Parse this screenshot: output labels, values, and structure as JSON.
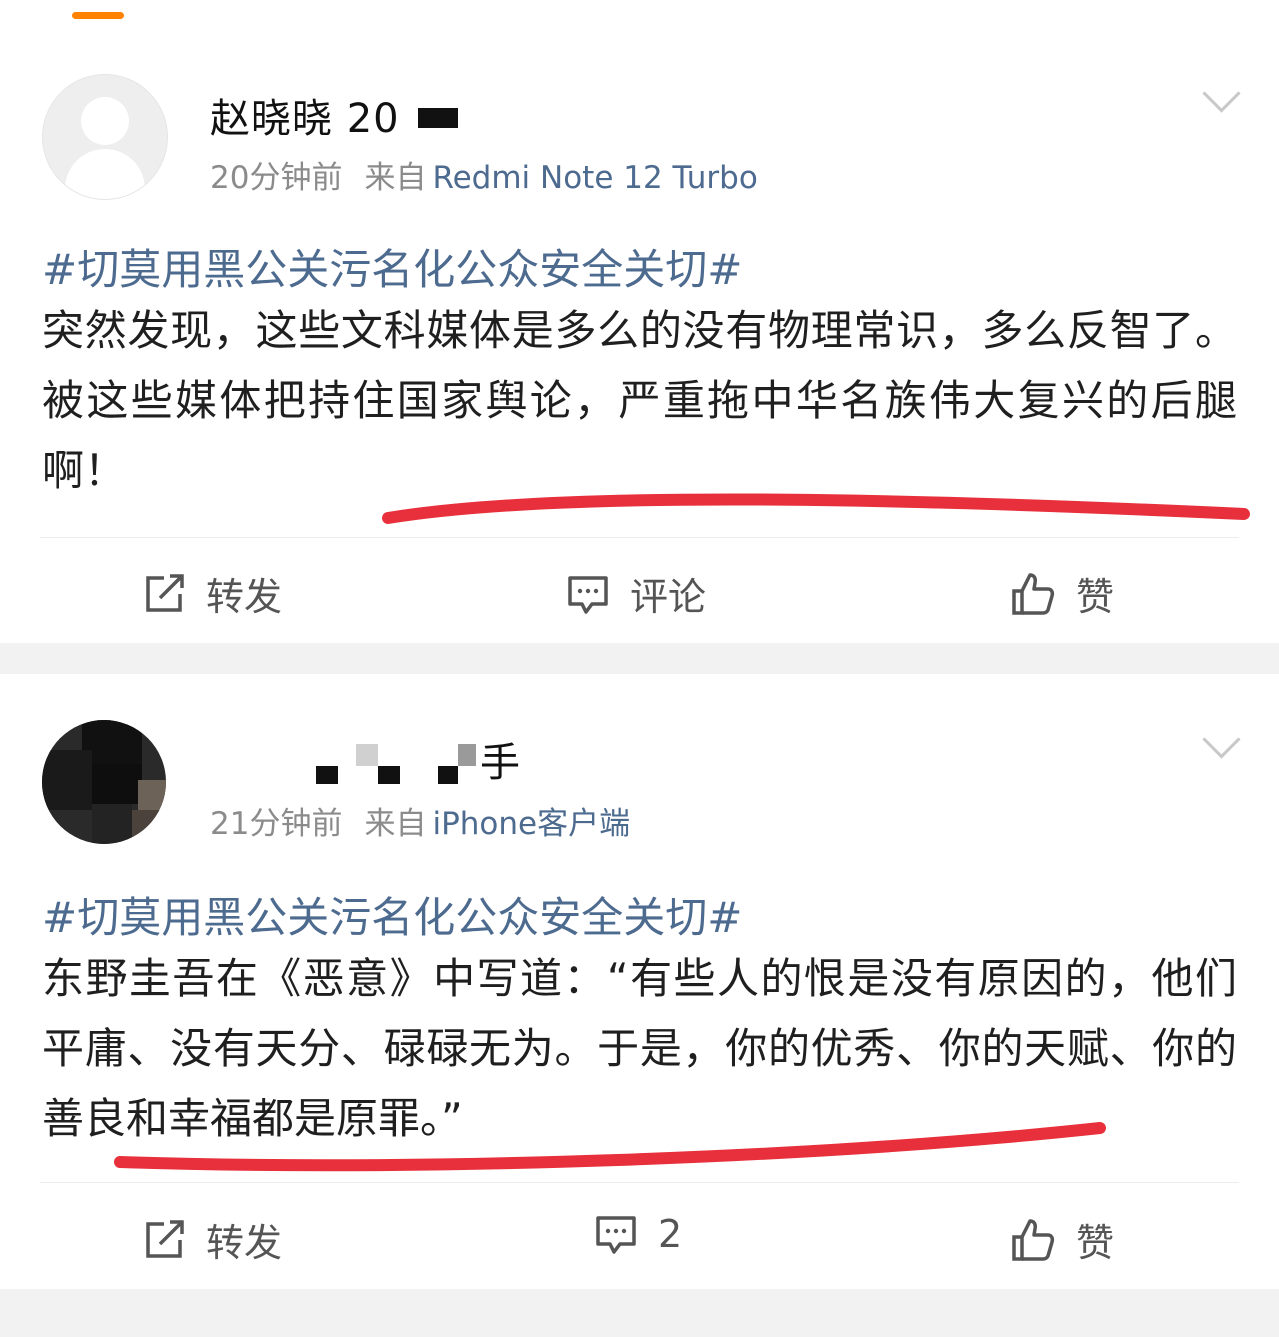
{
  "posts": [
    {
      "username": "赵晓晓 20",
      "time": "20分钟前",
      "source_label": "来自",
      "source": "Redmi Note 12 Turbo",
      "topic": "#切莫用黑公关污名化公众安全关切#",
      "text": "突然发现，这些文科媒体是多么的没有物理常识，多么反智了。被这些媒体把持住国家舆论，严重拖中华名族伟大复兴的后腿啊！",
      "actions": {
        "repost": "转发",
        "comment": "评论",
        "like": "赞"
      }
    },
    {
      "username": "手",
      "time": "21分钟前",
      "source_label": "来自",
      "source": "iPhone客户端",
      "topic": "#切莫用黑公关污名化公众安全关切#",
      "text": "东野圭吾在《恶意》中写道：“有些人的恨是没有原因的，他们平庸、没有天分、碌碌无为。于是，你的优秀、你的天赋、你的善良和幸福都是原罪。”",
      "actions": {
        "repost": "转发",
        "comment": "2",
        "like": "赞"
      }
    }
  ],
  "colors": {
    "accent": "#ff8200",
    "link": "#4d6a8f",
    "underline": "#e8303c"
  },
  "icons": [
    "repost-icon",
    "comment-icon",
    "like-icon",
    "chevron-down-icon"
  ]
}
